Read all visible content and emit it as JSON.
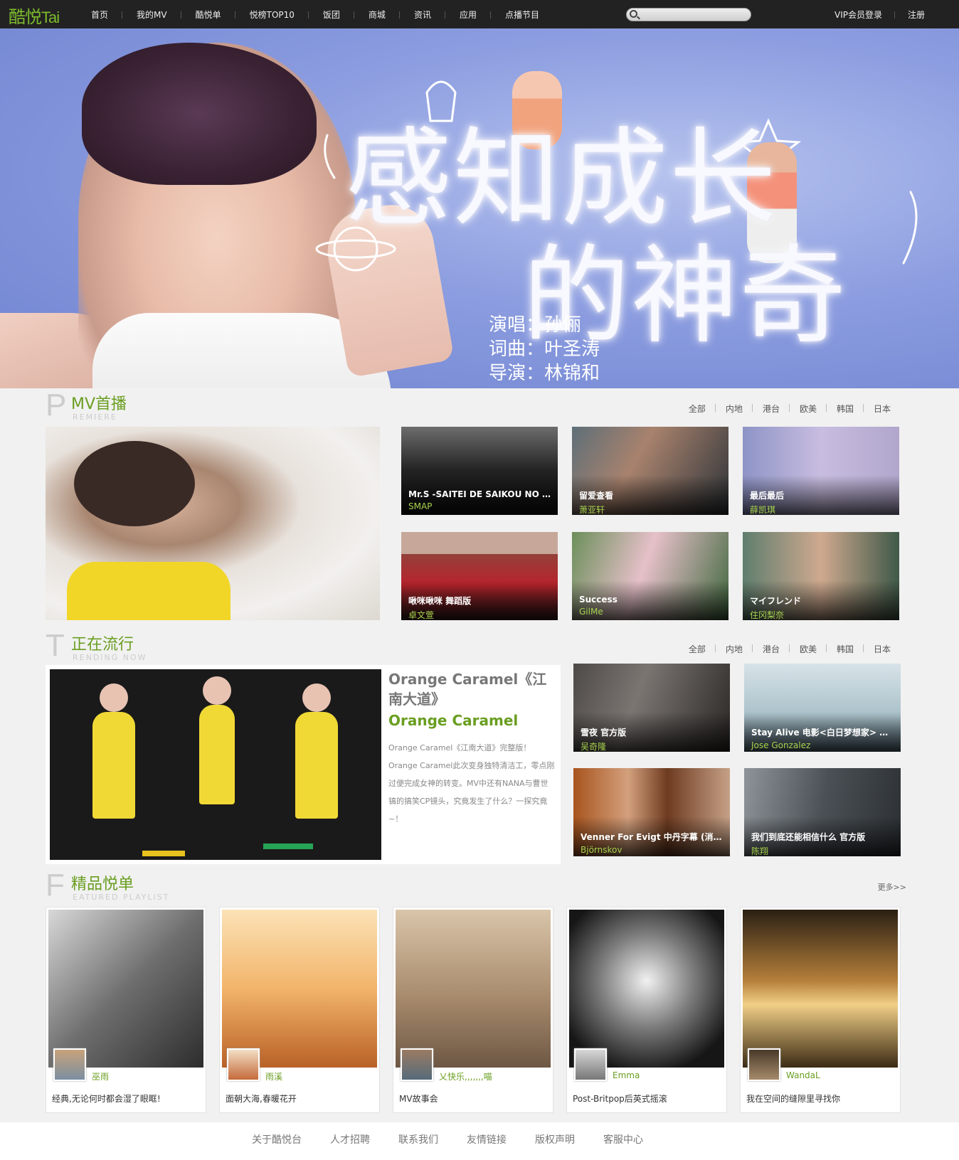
{
  "nav": {
    "logo": "酷悦",
    "logo_sub": "Tai",
    "items": [
      "首页",
      "我的MV",
      "酷悦单",
      "悦榜TOP10",
      "饭团",
      "商城",
      "资讯",
      "应用",
      "点播节目"
    ],
    "vip_login": "VIP会员登录",
    "register": "注册"
  },
  "hero": {
    "title_line1": "感知成长",
    "title_line2": "的神奇",
    "credit_singer": "演唱：孙俪",
    "credit_lyrics": "词曲：叶圣涛",
    "credit_director": "导演：林锦和"
  },
  "premiere": {
    "letter": "P",
    "title": "MV首播",
    "en": "REMIERE",
    "filters": [
      "全部",
      "内地",
      "港台",
      "欧美",
      "韩国",
      "日本"
    ],
    "cards": [
      {
        "title": "Mr.S -SAITEI DE SAIKOU NO O...",
        "artist": "SMAP"
      },
      {
        "title": "留爱查看",
        "artist": "萧亚轩"
      },
      {
        "title": "最后最后",
        "artist": "薛凯琪"
      },
      {
        "title": "啾咪啾咪 舞蹈版",
        "artist": "卓文萱"
      },
      {
        "title": "Success",
        "artist": "GilMe"
      },
      {
        "title": "マイフレンド",
        "artist": "住冈梨奈"
      }
    ]
  },
  "trending": {
    "letter": "T",
    "title": "正在流行",
    "en": "RENDING NOW",
    "filters": [
      "全部",
      "内地",
      "港台",
      "欧美",
      "韩国",
      "日本"
    ],
    "feature": {
      "title": "Orange Caramel《江南大道》",
      "artist": "Orange Caramel",
      "desc": "Orange Caramel《江南大道》完整版！Orange Caramel此次变身独特清洁工，零点刚过便完成女神的转变。MV中还有NANA与曹世镐的搞笑CP镜头，究竟发生了什么？一探究竟~！"
    },
    "cards": [
      {
        "title": "雪夜 官方版",
        "artist": "吴奇隆"
      },
      {
        "title": "Stay Alive 电影<白日梦想家> 插...",
        "artist": "Jose Gonzalez"
      },
      {
        "title": "Venner For Evigt 中丹字幕 (消息...",
        "artist": "Björnskov"
      },
      {
        "title": "我们到底还能相信什么 官方版",
        "artist": "陈翔"
      }
    ]
  },
  "playlists": {
    "letter": "F",
    "title": "精品悦单",
    "en": "EATURED PLAYLIST",
    "more": "更多>>",
    "items": [
      {
        "user": "巫雨",
        "desc": "经典,无论何时都会湿了眼眶!"
      },
      {
        "user": "雨溪",
        "desc": "面朝大海,春暖花开"
      },
      {
        "user": "乂快乐,,,,,,,喵",
        "desc": "MV故事会"
      },
      {
        "user": "Emma",
        "desc": "Post-Britpop后英式摇滚"
      },
      {
        "user": "WandaL",
        "desc": "我在空间的缝隙里寻找你"
      }
    ]
  },
  "footer": {
    "links": [
      "关于酷悦台",
      "人才招聘",
      "联系我们",
      "友情链接",
      "版权声明",
      "客服中心"
    ]
  }
}
